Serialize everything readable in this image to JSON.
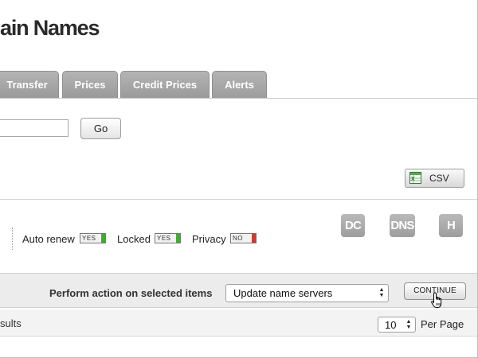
{
  "page": {
    "title": "ain Names"
  },
  "tabs": [
    {
      "label": "Transfer"
    },
    {
      "label": "Prices"
    },
    {
      "label": "Credit Prices"
    },
    {
      "label": "Alerts"
    }
  ],
  "search": {
    "value": "",
    "go_label": "Go"
  },
  "export": {
    "csv_label": "CSV",
    "icon": "excel-icon"
  },
  "filters": {
    "auto_renew": {
      "label": "Auto renew",
      "state": "YES",
      "color": "#3fae2a"
    },
    "locked": {
      "label": "Locked",
      "state": "YES",
      "color": "#3fae2a"
    },
    "privacy": {
      "label": "Privacy",
      "state": "NO",
      "color": "#d23a2a"
    }
  },
  "action_icons": [
    {
      "label": "DC"
    },
    {
      "label": "DNS"
    },
    {
      "label": "H"
    }
  ],
  "bulk_action": {
    "label": "Perform action on selected items",
    "selected": "Update name servers",
    "continue_label": "CONTINUE"
  },
  "results": {
    "text": "sults",
    "per_page_value": "10",
    "per_page_label": "Per Page"
  },
  "colors": {
    "tab_background": "#a8a8a8",
    "action_bar": "#ececec",
    "yes_knob": "#3fae2a",
    "no_knob": "#d23a2a"
  }
}
